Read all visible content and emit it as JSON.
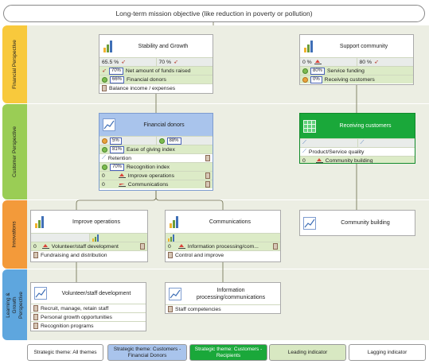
{
  "header": {
    "title": "Long-term mission objective (like reduction in poverty or pollution)"
  },
  "lanes": [
    {
      "label": "Financial Perspective",
      "color": "#f8c93c"
    },
    {
      "label": "Customer Perspective",
      "color": "#9acd55"
    },
    {
      "label": "Innovations",
      "color": "#f39a3a"
    },
    {
      "label": "Learning & Growth Perspective",
      "color": "#5ea6de"
    }
  ],
  "financial": {
    "stability": {
      "title": "Stability and Growth",
      "left_pct": "65.5 %",
      "right_pct": "70 %",
      "rows": [
        {
          "value": "70%",
          "label": "Net amount of funds raised"
        },
        {
          "value": "66%",
          "label": "Financial donors"
        },
        {
          "value": "",
          "label": "Balance income / expenses"
        }
      ]
    },
    "support": {
      "title": "Support community",
      "left_pct": "0 %",
      "right_pct": "80 %",
      "rows": [
        {
          "value": "80%",
          "label": "Service funding"
        },
        {
          "value": "0%",
          "label": "Receiving customers"
        }
      ]
    }
  },
  "customer": {
    "donors": {
      "title": "Financial donors",
      "left_val": "5%",
      "right_val": "88%",
      "rows": [
        {
          "value": "81%",
          "label": "Ease of giving index"
        },
        {
          "value": "",
          "label": "Retention"
        },
        {
          "value": "70%",
          "label": "Recognition index"
        },
        {
          "value": "0",
          "label": "Improve operations"
        },
        {
          "value": "0",
          "label": "Communications"
        }
      ]
    },
    "receiving": {
      "title": "Receiving customers",
      "rows": [
        {
          "value": "",
          "label": "Product/Service quality"
        },
        {
          "value": "0",
          "label": "Community building"
        }
      ]
    }
  },
  "innovations": {
    "improve": {
      "title": "Improve operations",
      "rows": [
        {
          "value": "0",
          "label": "Volunteer/staff development"
        },
        {
          "value": "",
          "label": "Fundraising and distribution"
        }
      ]
    },
    "comms": {
      "title": "Communications",
      "rows": [
        {
          "value": "0",
          "label": "Information  processing/com..."
        },
        {
          "value": "",
          "label": "Control and improve"
        }
      ]
    },
    "community": {
      "title": "Community building"
    }
  },
  "learning": {
    "volunteer": {
      "title": "Volunteer/staff development",
      "rows": [
        {
          "label": "Recruit, manage, retain staff"
        },
        {
          "label": "Personal growth opportunities"
        },
        {
          "label": "Recognition programs"
        }
      ]
    },
    "info": {
      "title": "Information processing/communications",
      "rows": [
        {
          "label": "Staff competencies"
        }
      ]
    }
  },
  "legend": [
    {
      "label": "Strategic theme: All themes",
      "bg": "#ffffff",
      "fg": "#222222"
    },
    {
      "label": "Strategic theme: Customers - Financial Donors",
      "bg": "#a9c4ec",
      "fg": "#222222"
    },
    {
      "label": "Strategic theme: Customers - Recipients",
      "bg": "#1aa83a",
      "fg": "#ffffff"
    },
    {
      "label": "Leading indicator",
      "bg": "#d8e8c2",
      "fg": "#222222"
    },
    {
      "label": "Lagging indicator",
      "bg": "#ffffff",
      "fg": "#222222"
    }
  ]
}
